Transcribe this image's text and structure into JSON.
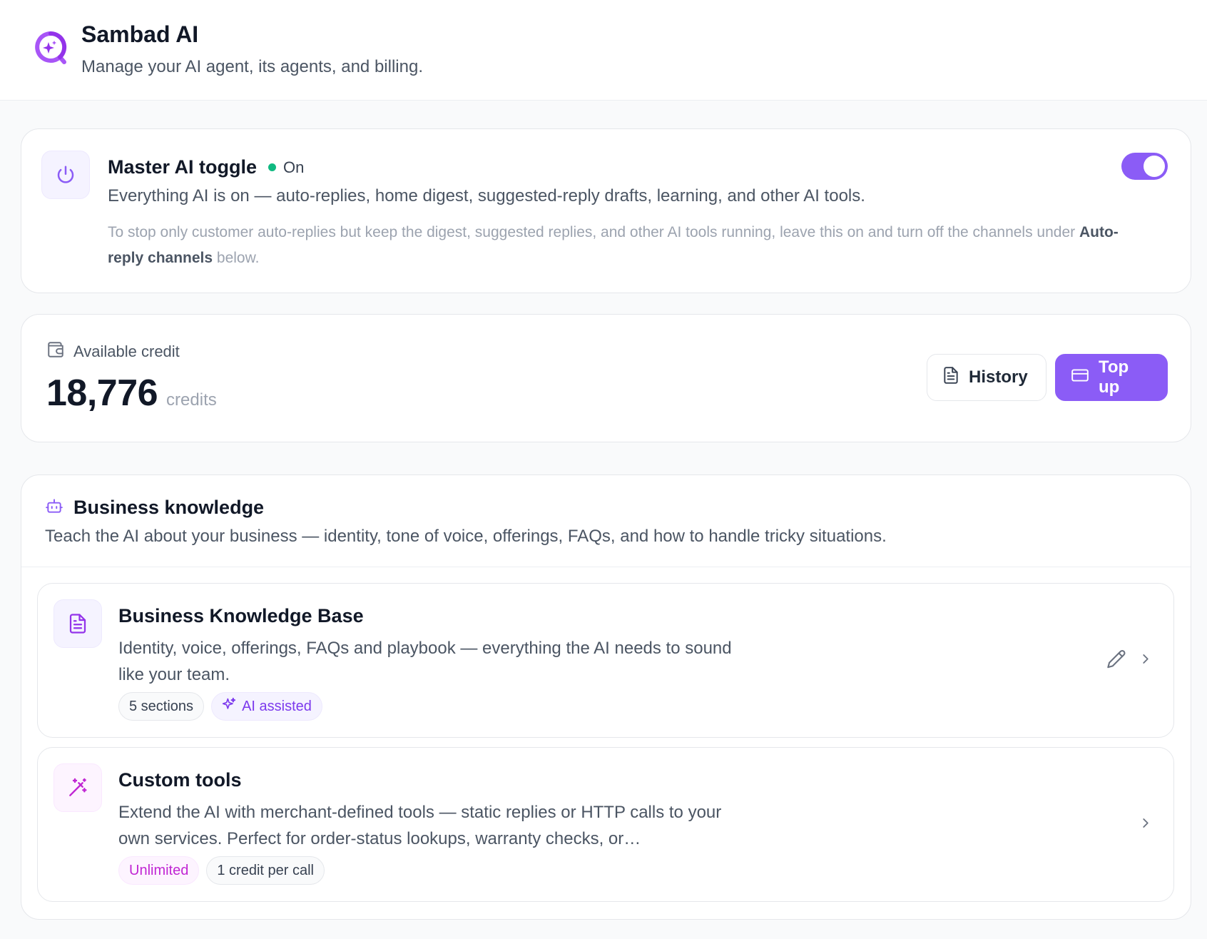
{
  "header": {
    "title": "Sambad AI",
    "subtitle": "Manage your AI agent, its agents, and billing.",
    "logo_icon": "sparkle-chat-icon"
  },
  "master": {
    "title": "Master AI toggle",
    "status": "On",
    "description": "Everything AI is on — auto-replies, home digest, suggested-reply drafts, learning, and other AI tools.",
    "note_prefix": "To stop only customer auto-replies but keep the digest, suggested replies, and other AI tools running, leave this on and turn off the channels under ",
    "note_strong": "Auto-reply channels",
    "note_suffix": " below.",
    "toggle_on": true,
    "icon": "power-icon"
  },
  "credit": {
    "label": "Available credit",
    "value": "18,776",
    "unit": "credits",
    "history_label": "History",
    "topup_label": "Top up",
    "icon": "wallet-icon"
  },
  "knowledge": {
    "title": "Business knowledge",
    "description": "Teach the AI about your business — identity, tone of voice, offerings, FAQs, and how to handle tricky situations.",
    "icon": "bot-icon",
    "items": [
      {
        "title": "Business Knowledge Base",
        "description": "Identity, voice, offerings, FAQs and playbook — everything the AI needs to sound like your team.",
        "tags": [
          "5 sections",
          "AI assisted"
        ]
      },
      {
        "title": "Custom tools",
        "description": "Extend the AI with merchant-defined tools — static replies or HTTP calls to your own services. Perfect for order-status lookups, warranty checks, or…",
        "tags": [
          "Unlimited",
          "1 credit per call"
        ]
      }
    ]
  },
  "colors": {
    "accent": "#8b5cf6",
    "status_on": "#10b981",
    "magenta": "#c026d3"
  }
}
